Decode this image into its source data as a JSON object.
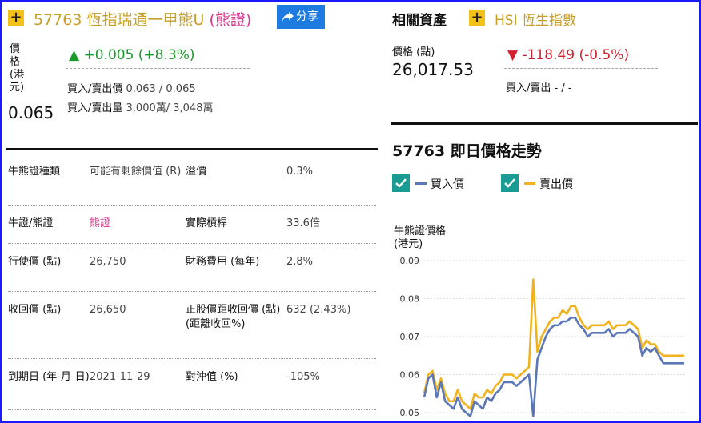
{
  "warrant": {
    "code_title": "57763 恆指瑞通一甲熊U",
    "type_tag": "(熊證)",
    "share_label": "分享",
    "price_label_lines": [
      "價",
      "格",
      "(港",
      "元)"
    ],
    "price": "0.065",
    "change": "+0.005 (+8.3%)",
    "bid_ask_price_label": "買入/賣出價",
    "bid_ask_price": "0.063 / 0.065",
    "bid_ask_volume_label": "買入/賣出量",
    "bid_ask_volume": "3,000萬/ 3,048萬"
  },
  "specs": [
    {
      "k1": "牛熊證種類",
      "v1": "可能有剩餘價值 (R)",
      "k2": "溢價",
      "v2": "0.3%"
    },
    {
      "k1": "牛證/熊證",
      "v1": "熊證",
      "k2": "實際槓桿",
      "v2": "33.6倍"
    },
    {
      "k1": "行使價 (點)",
      "v1": "26,750",
      "k2": "財務費用 (每年)",
      "v2": "2.8%"
    },
    {
      "k1": "收回價 (點)",
      "v1": "26,650",
      "k2": "正股價距收回價 (點) (距離收回%)",
      "v2": "632 (2.43%)"
    },
    {
      "k1": "到期日 (年-月-日)",
      "v1": "2021-11-29",
      "k2": "對沖值 (%)",
      "v2": "-105%"
    }
  ],
  "related": {
    "label": "相關資產",
    "asset": "HSI 恆生指數",
    "price_label": "價格 (點)",
    "price": "26,017.53",
    "change": "-118.49 (-0.5%)",
    "bid_ask": "買入/賣出 - / -"
  },
  "chart_section": {
    "title": "57763 即日價格走勢",
    "legend_bid": "買入價",
    "legend_ask": "賣出價",
    "ylabel_1": "牛熊證價格",
    "ylabel_2": "(港元)"
  },
  "colors": {
    "bid": "#5a78b5",
    "ask": "#f2b21c",
    "up": "#1a9a2a",
    "down": "#d01f2f",
    "accent": "#f2c21b",
    "check": "#1a9b94"
  },
  "chart_data": {
    "type": "line",
    "ylim": [
      0.048,
      0.09
    ],
    "yticks": [
      "0.09",
      "0.08",
      "0.07",
      "0.06",
      "0.05"
    ],
    "grid": true,
    "series": [
      {
        "name": "買入價",
        "values": [
          0.054,
          0.059,
          0.06,
          0.054,
          0.058,
          0.053,
          0.052,
          0.051,
          0.054,
          0.051,
          0.05,
          0.049,
          0.053,
          0.052,
          0.051,
          0.054,
          0.053,
          0.055,
          0.056,
          0.058,
          0.058,
          0.058,
          0.057,
          0.058,
          0.059,
          0.06,
          0.049,
          0.064,
          0.067,
          0.07,
          0.072,
          0.073,
          0.073,
          0.074,
          0.074,
          0.075,
          0.075,
          0.073,
          0.072,
          0.07,
          0.071,
          0.071,
          0.071,
          0.071,
          0.072,
          0.07,
          0.071,
          0.071,
          0.071,
          0.072,
          0.071,
          0.07,
          0.065,
          0.067,
          0.066,
          0.067,
          0.065,
          0.063,
          0.063,
          0.063,
          0.063,
          0.063,
          0.063
        ]
      },
      {
        "name": "賣出價",
        "values": [
          0.055,
          0.06,
          0.061,
          0.056,
          0.059,
          0.055,
          0.053,
          0.053,
          0.056,
          0.053,
          0.052,
          0.051,
          0.055,
          0.054,
          0.054,
          0.056,
          0.055,
          0.057,
          0.058,
          0.06,
          0.06,
          0.06,
          0.059,
          0.06,
          0.061,
          0.062,
          0.085,
          0.066,
          0.07,
          0.072,
          0.074,
          0.075,
          0.075,
          0.077,
          0.076,
          0.078,
          0.078,
          0.075,
          0.073,
          0.072,
          0.073,
          0.073,
          0.073,
          0.073,
          0.074,
          0.072,
          0.073,
          0.073,
          0.073,
          0.074,
          0.073,
          0.072,
          0.067,
          0.069,
          0.068,
          0.068,
          0.066,
          0.065,
          0.065,
          0.065,
          0.065,
          0.065,
          0.065
        ]
      }
    ]
  }
}
